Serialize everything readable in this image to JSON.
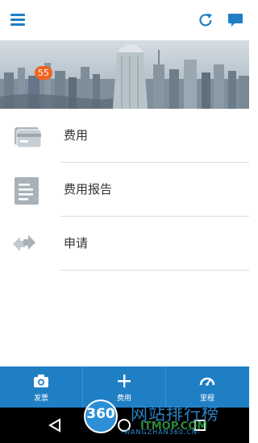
{
  "header": {
    "menu_icon": "hamburger-menu-icon",
    "refresh_icon": "refresh-icon",
    "chat_icon": "chat-bubble-icon",
    "accent_color": "#1f7fc4"
  },
  "hero": {
    "image": "city-skyline-photo"
  },
  "list": {
    "items": [
      {
        "label": "费用",
        "icon": "credit-card-icon"
      },
      {
        "label": "费用报告",
        "icon": "report-document-icon",
        "badge": "55"
      },
      {
        "label": "申请",
        "icon": "request-arrows-icon"
      }
    ]
  },
  "action_bar": {
    "background": "#1f7fc4",
    "items": [
      {
        "label": "发票",
        "icon": "camera-icon"
      },
      {
        "label": "费用",
        "icon": "plus-icon"
      },
      {
        "label": "里程",
        "icon": "speedometer-icon"
      }
    ]
  },
  "nav_bar": {
    "back_icon": "back-triangle-icon",
    "home_icon": "home-circle-icon",
    "recent_icon": "recent-square-icon"
  },
  "watermark": {
    "logo_text": "360",
    "title": "网站排行榜",
    "site": "-WANGZHAN360.CN-",
    "overlay": "ITMOP.COM"
  }
}
